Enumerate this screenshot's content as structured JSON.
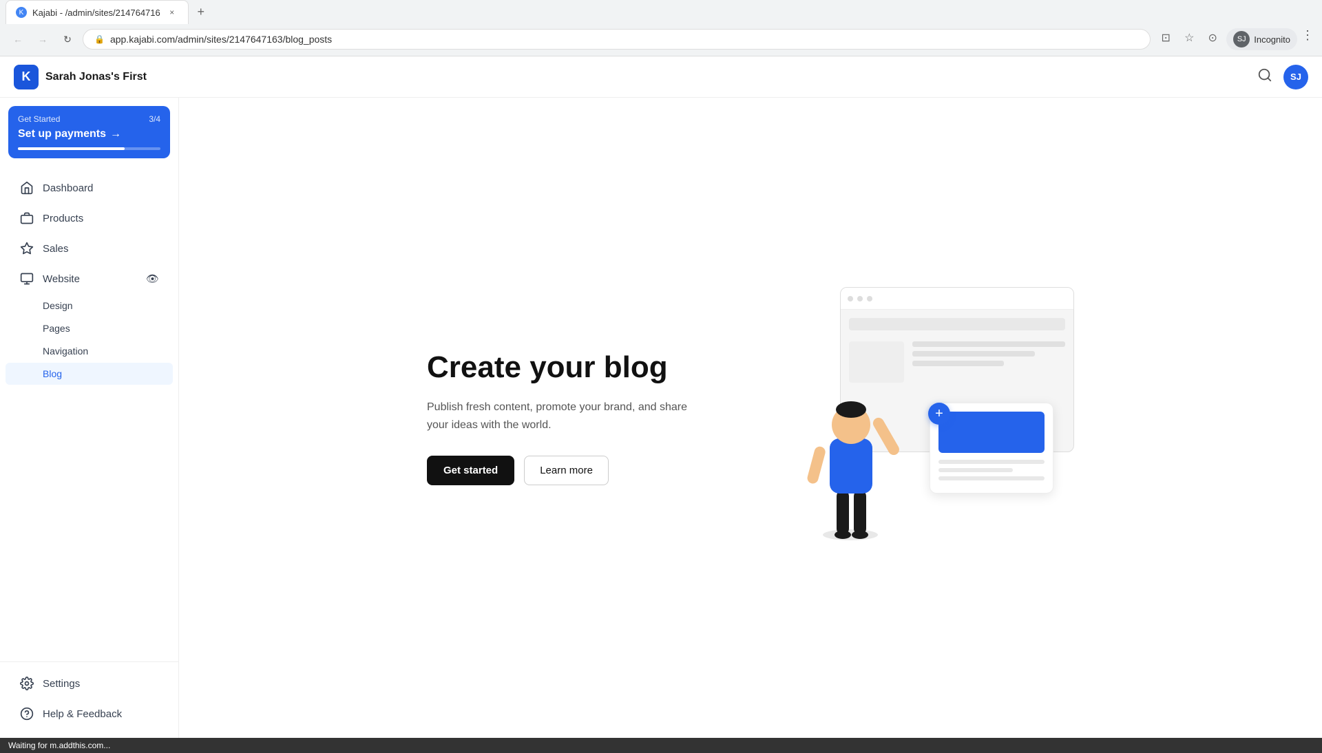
{
  "browser": {
    "tab_title": "Kajabi - /admin/sites/214764716",
    "tab_close": "×",
    "new_tab": "+",
    "back_disabled": true,
    "forward_disabled": true,
    "reload_label": "↻",
    "address": "app.kajabi.com/admin/sites/2147647163/blog_posts",
    "lock_icon": "🔒",
    "bookmark_icon": "☆",
    "sidebar_icon": "▣",
    "incognito_label": "Incognito",
    "incognito_initials": "SJ",
    "more_icon": "⋮"
  },
  "header": {
    "logo_letter": "K",
    "site_name": "Sarah Jonas's First",
    "search_icon": "search",
    "user_initials": "SJ"
  },
  "sidebar": {
    "get_started": {
      "label": "Get Started",
      "count": "3/4",
      "cta": "Set up payments",
      "arrow": "→",
      "progress_percent": 75
    },
    "nav_items": [
      {
        "id": "dashboard",
        "label": "Dashboard",
        "icon": "home"
      },
      {
        "id": "products",
        "label": "Products",
        "icon": "tag"
      },
      {
        "id": "sales",
        "label": "Sales",
        "icon": "diamond"
      },
      {
        "id": "website",
        "label": "Website",
        "icon": "monitor",
        "has_expand": true,
        "expand_icon": "👁"
      }
    ],
    "website_sub_items": [
      {
        "id": "design",
        "label": "Design"
      },
      {
        "id": "pages",
        "label": "Pages"
      },
      {
        "id": "navigation",
        "label": "Navigation"
      },
      {
        "id": "blog",
        "label": "Blog",
        "active": true
      }
    ],
    "bottom_items": [
      {
        "id": "settings",
        "label": "Settings",
        "icon": "gear"
      },
      {
        "id": "help",
        "label": "Help & Feedback",
        "icon": "question"
      }
    ]
  },
  "main": {
    "title": "Create your blog",
    "description": "Publish fresh content, promote your brand, and share your ideas with the world.",
    "get_started_btn": "Get started",
    "learn_more_btn": "Learn more"
  },
  "status_bar": {
    "text": "Waiting for m.addthis.com..."
  }
}
